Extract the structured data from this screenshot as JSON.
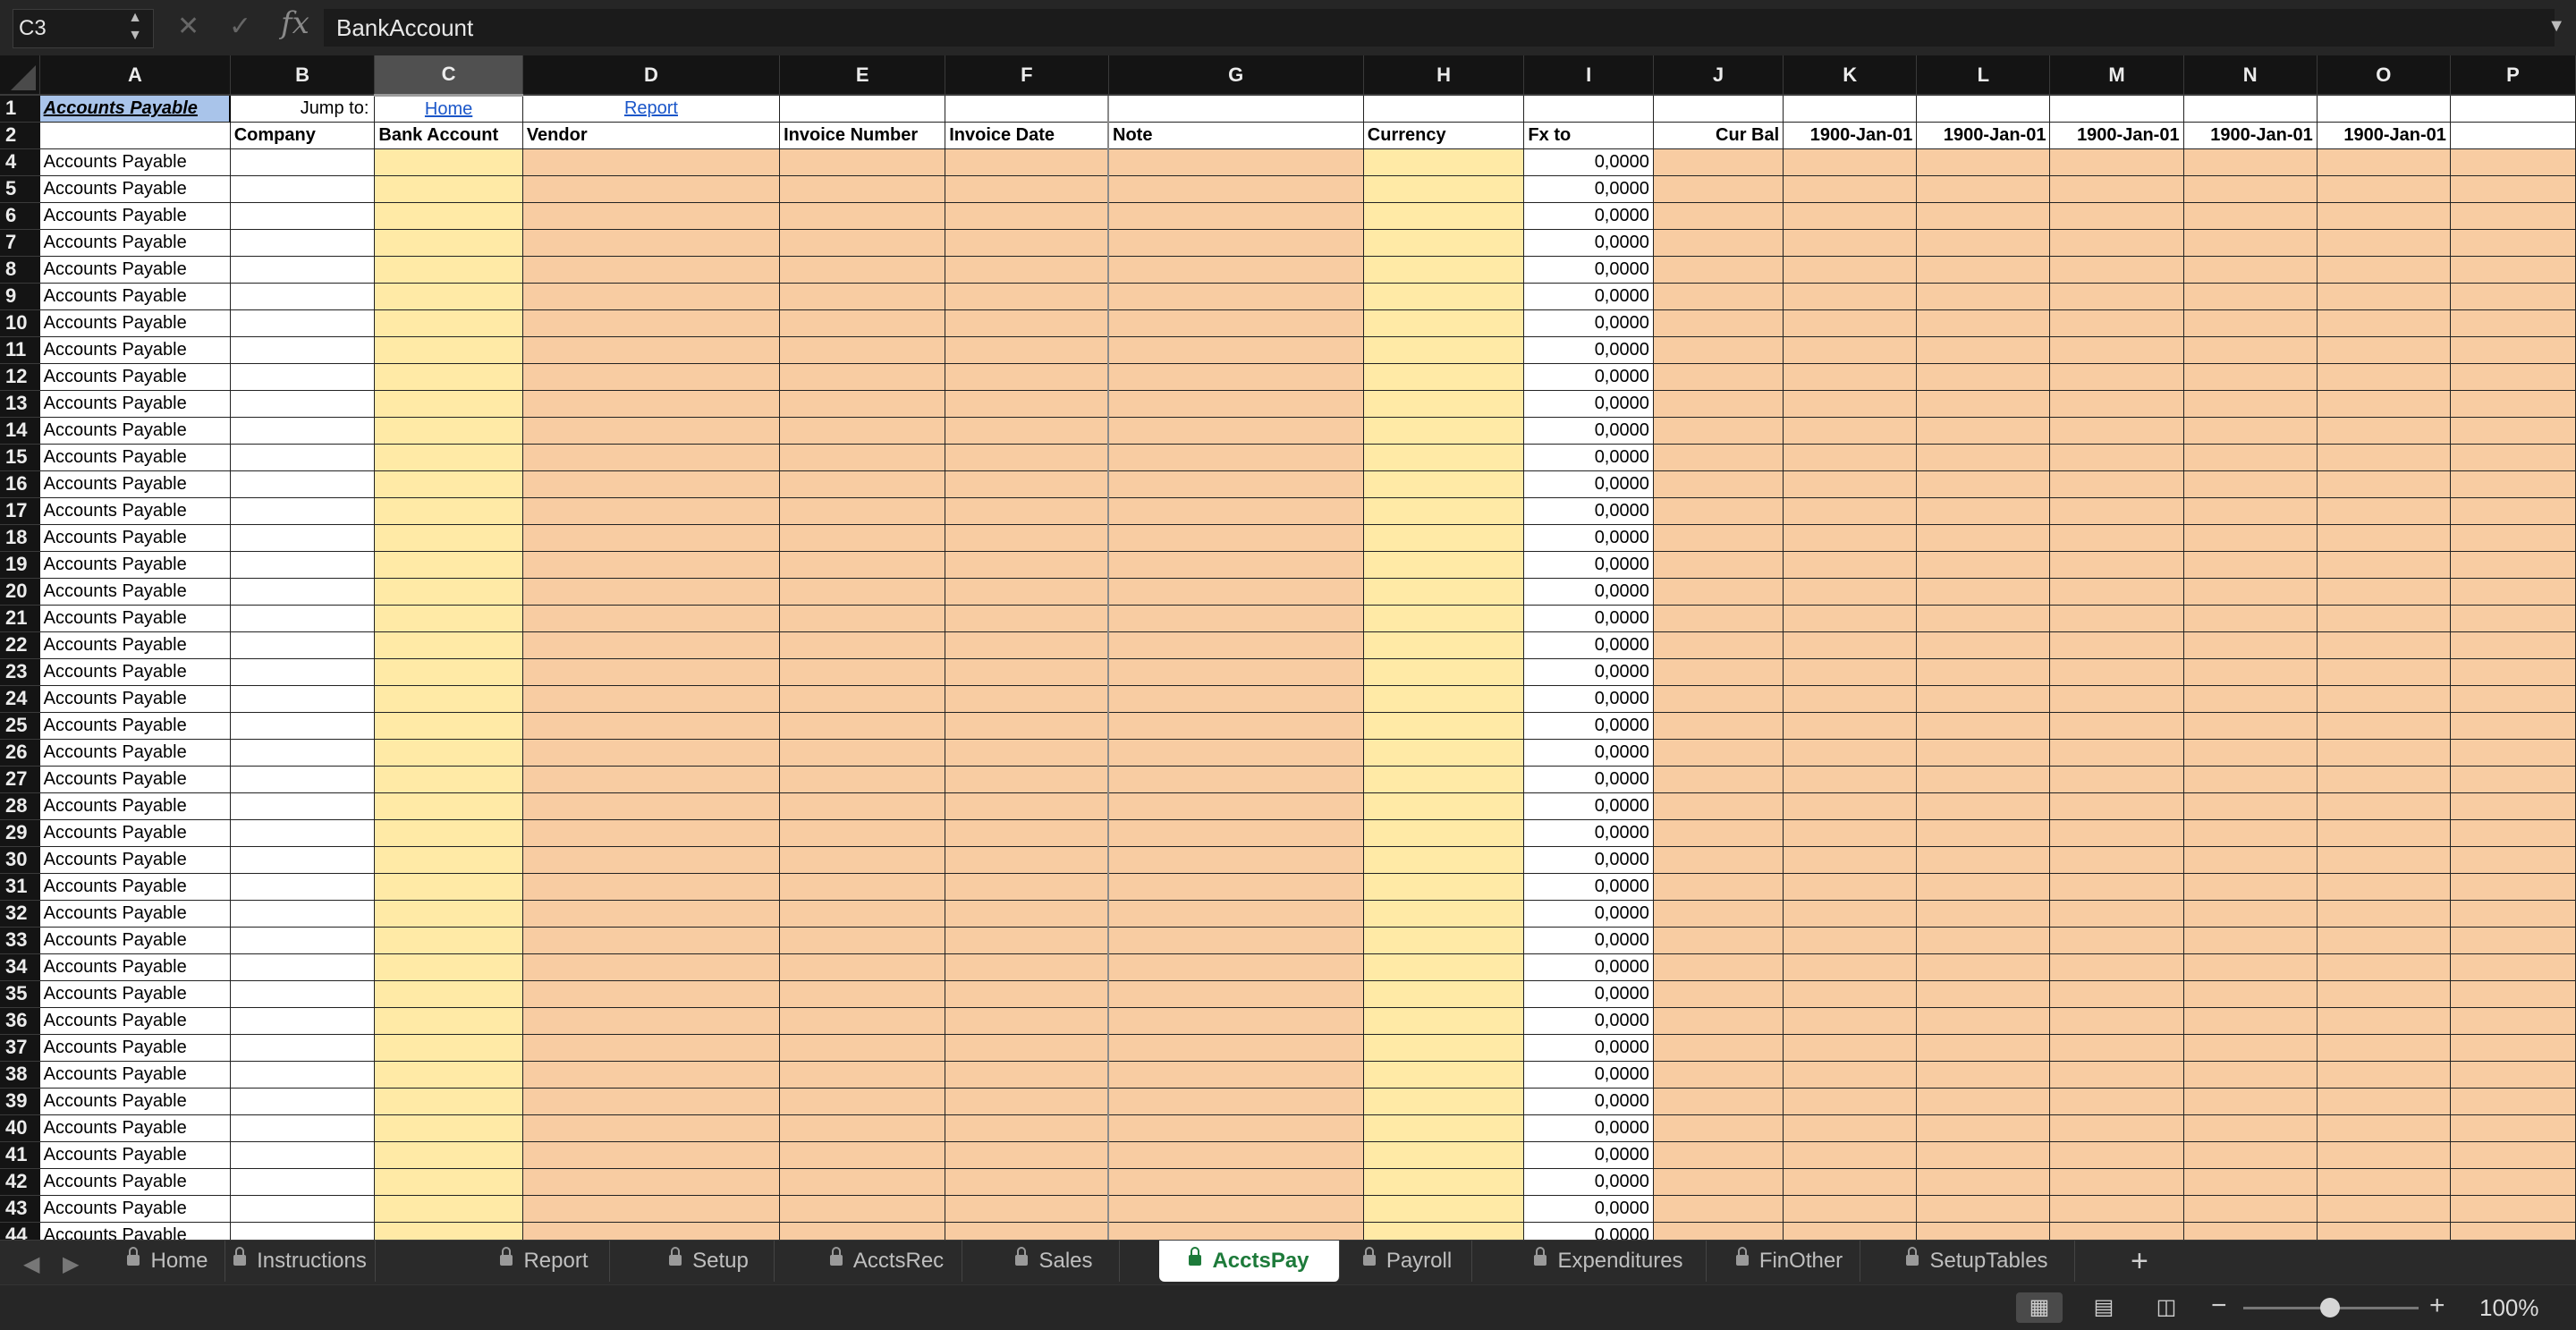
{
  "formula_bar": {
    "name_box": "C3",
    "cancel_icon": "✕",
    "enter_icon": "✓",
    "fx_label": "fx",
    "content": "BankAccount"
  },
  "columns": [
    "A",
    "B",
    "C",
    "D",
    "E",
    "F",
    "G",
    "H",
    "I",
    "J",
    "K",
    "L",
    "M",
    "N",
    "O",
    "P"
  ],
  "row1": {
    "title": "Accounts Payable",
    "jump_label": "Jump to:",
    "link_home": "Home",
    "link_report": "Report"
  },
  "row2": {
    "company": "Company",
    "bank_account": "Bank Account",
    "vendor": "Vendor",
    "invoice_number": "Invoice Number",
    "invoice_date": "Invoice Date",
    "note": "Note",
    "currency": "Currency",
    "fx_to": "Fx to",
    "cur_bal": "Cur Bal",
    "dates": [
      "1900-Jan-01",
      "1900-Jan-01",
      "1900-Jan-01",
      "1900-Jan-01",
      "1900-Jan-01"
    ]
  },
  "row_label": "Accounts Payable",
  "fx_value": "0,0000",
  "row_numbers": [
    4,
    5,
    6,
    7,
    8,
    9,
    10,
    11,
    12,
    13,
    14,
    15,
    16,
    17,
    18,
    19,
    20,
    21,
    22,
    23,
    24,
    25,
    26,
    27,
    28,
    29,
    30,
    31,
    32,
    33,
    34,
    35,
    36,
    37,
    38,
    39,
    40,
    41,
    42,
    43,
    44
  ],
  "sheet_tabs": [
    "Home",
    "Instructions",
    "Report",
    "Setup",
    "AcctsRec",
    "Sales",
    "AcctsPay",
    "Payroll",
    "Expenditures",
    "FinOther",
    "SetupTables"
  ],
  "active_tab": "AcctsPay",
  "add_sheet": "+",
  "zoom": "100%"
}
